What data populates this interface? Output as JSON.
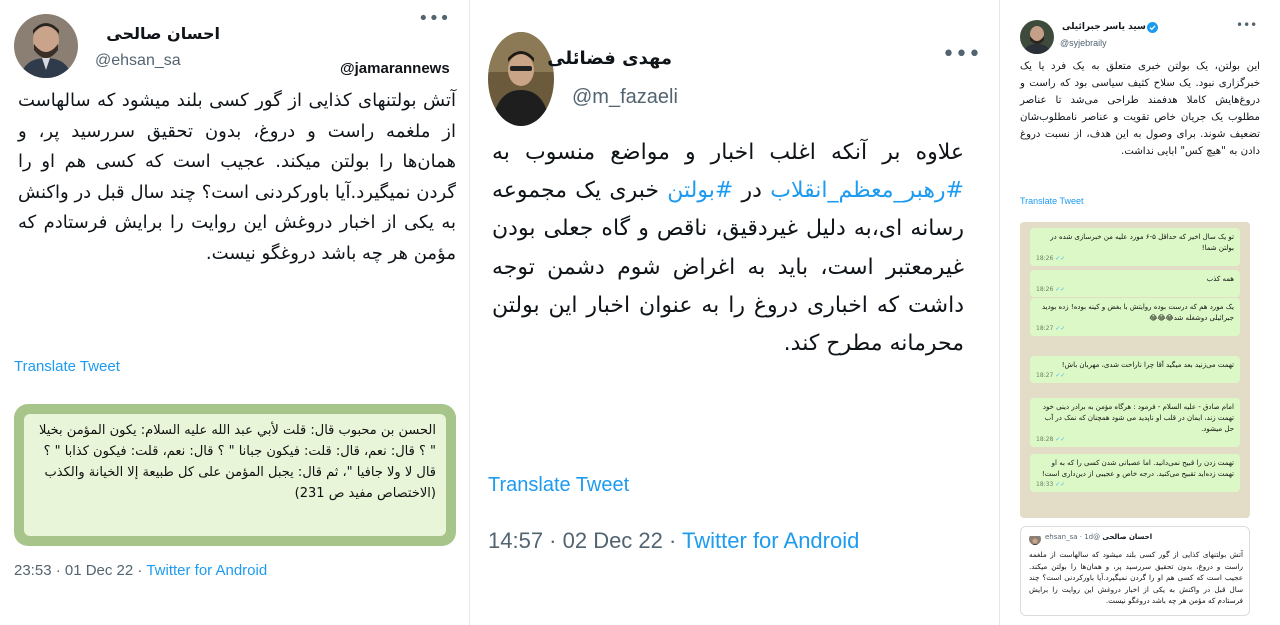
{
  "tweet_left": {
    "author_name": "احسان صالحی",
    "handle": "@ehsan_sa",
    "more_icon": "more-horizontal-icon",
    "watermark": "@jamarannews",
    "body": "آتش بولتنهای کذایی از گور کسی بلند میشود که سالهاست از ملغمه راست و دروغ، بدون تحقیق سررسید پر، و همان‌ها را بولتن میکند. عجیب است که کسی هم او را گردن نمیگیرد.آیا باورکردنی است؟ چند سال قبل در واکنش به یکی از اخبار دروغش این روایت را برایش فرستادم که مؤمن هر چه باشد دروغگو نیست.",
    "translate_label": "Translate Tweet",
    "image_quote": "الحسن بن محبوب قال: قلت لأبي عبد الله عليه السلام: يكون المؤمن بخيلا \" ؟ قال: نعم، قال: قلت: فيكون جبانا \" ؟ قال: نعم، قلت: فيكون كذابا \" ؟ قال لا ولا جافيا \"، ثم قال: يجبل المؤمن على كل طبيعة إلا الخيانة والكذب (الاختصاص مفيد ص 231)",
    "time": "23:53 · 01 Dec 22 · ",
    "source": "Twitter for Android"
  },
  "tweet_middle": {
    "author_name": "مهدی فضائلی",
    "handle": "@m_fazaeli",
    "more_icon": "more-horizontal-icon",
    "body_part1": "علاوه بر آنکه اغلب اخبار و مواضع منسوب به ",
    "hashtag1": "#رهبر_معظم_انقلاب",
    "body_part2": " در ",
    "hashtag2": "#بولتن",
    "body_part3": " خبری یک مجموعه رسانه ای،به دلیل غیردقیق، ناقص و گاه جعلی بودن غیرمعتبر است، باید به اغراض شوم دشمن توجه داشت که اخباری دروغ را به عنوان اخبار این بولتن محرمانه مطرح کند.",
    "translate_label": "Translate Tweet",
    "time": "14:57 · 02 Dec 22 · ",
    "source": "Twitter for Android"
  },
  "tweet_right": {
    "author_name": "سید یاسر جبرائیلی",
    "verified_icon": "verified-badge-icon",
    "handle": "@syjebraily",
    "more_icon": "more-horizontal-icon",
    "body": "این بولتن، یک بولتن خبری متعلق به یک فرد یا یک خبرگزاری نبود. یک سلاح کثیف سیاسی بود که راست و دروغ‌هایش کاملا هدفمند طراحی می‌شد تا عناصر مطلوب یک جریان خاص تقویت و عناصر نامطلوب‌شان تضعیف شوند. برای وصول به این هدف، از نسبت دروغ دادن به \"هیچ کس\" ابایی نداشت.",
    "translate_label": "Translate Tweet",
    "chat_messages": [
      {
        "text": "تو یک سال اخیر که حداقل ۵-۶ مورد علیه من خبرسازی شده در بولتن شما!",
        "time": "18:26"
      },
      {
        "text": "همه کذب",
        "time": "18:26"
      },
      {
        "text": "یک مورد هم که درست بوده روایتش با بغض و کینه بوده! زده بودید جبرائیلی دوشغله شد😂😂😂",
        "time": "18:27"
      },
      {
        "text": "تهمت می‌زنید بعد میگید آقا چرا ناراحت شدی، مهربان باش!",
        "time": "18:27"
      },
      {
        "text": "امام صادق - علیه السلام - فرمود : هرگاه مؤمن به برادر دینی خود تهمت زند، ایمان در قلب او ناپدید می شود همچنان که نمک در آب حل میشود.",
        "time": "18:28"
      },
      {
        "text": "تهمت زدن را قبیح نمی‌دانید. اما عصبانی شدن کسی را که به او تهمت زده‌اید تقبیح می‌کنید. درجه خاص و عجیبی از دین‌داری است!",
        "time": "18:33"
      }
    ],
    "quoted_author": "احسان صالحی",
    "quoted_handle": "@ehsan_sa · 1d",
    "quoted_text": "آتش بولتنهای کذایی از گور کسی بلند میشود که سالهاست از ملغمه راست و دروغ، بدون تحقیق سررسید پر، و همان‌ها را بولتن میکند. عجیب است که کسی هم او را گردن نمیگیرد.آیا باورکردنی است؟ چند سال قبل در واکنش به یکی از اخبار دروغش این روایت را برایش فرستادم که مؤمن هر چه باشد دروغگو نیست."
  },
  "colors": {
    "link": "#1d9bf0",
    "secondary_text": "#536471",
    "primary_text": "#0f1419",
    "chat_bubble": "#dcf8c6",
    "chat_background": "#e3ddc7"
  }
}
